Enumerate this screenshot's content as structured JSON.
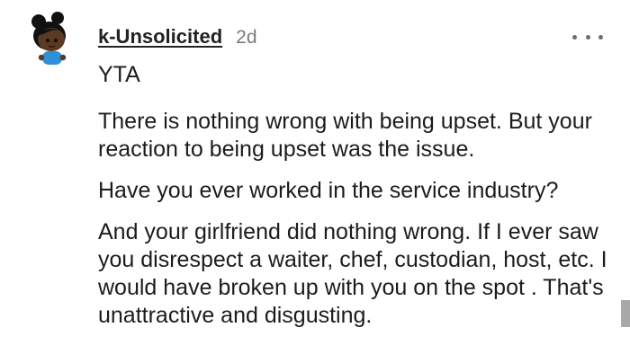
{
  "comment": {
    "author": "k-Unsolicited",
    "age": "2d",
    "avatar_icon": "snoo-avatar-icon",
    "more_icon": "more-options-icon",
    "paragraphs": [
      "YTA",
      "There is nothing wrong with being upset. But your reaction to being upset was the issue.",
      "Have you ever worked in the service industry?",
      "And your girlfriend did nothing wrong. If I ever saw you disrespect a waiter, chef, custodian, host, etc. I would have broken up with you on the spot . That's unattractive and disgusting."
    ]
  },
  "colors": {
    "text": "#1c1c1c",
    "meta": "#787c7e",
    "avatar_skin": "#5a3a22",
    "avatar_shirt": "#2f8fd8"
  }
}
